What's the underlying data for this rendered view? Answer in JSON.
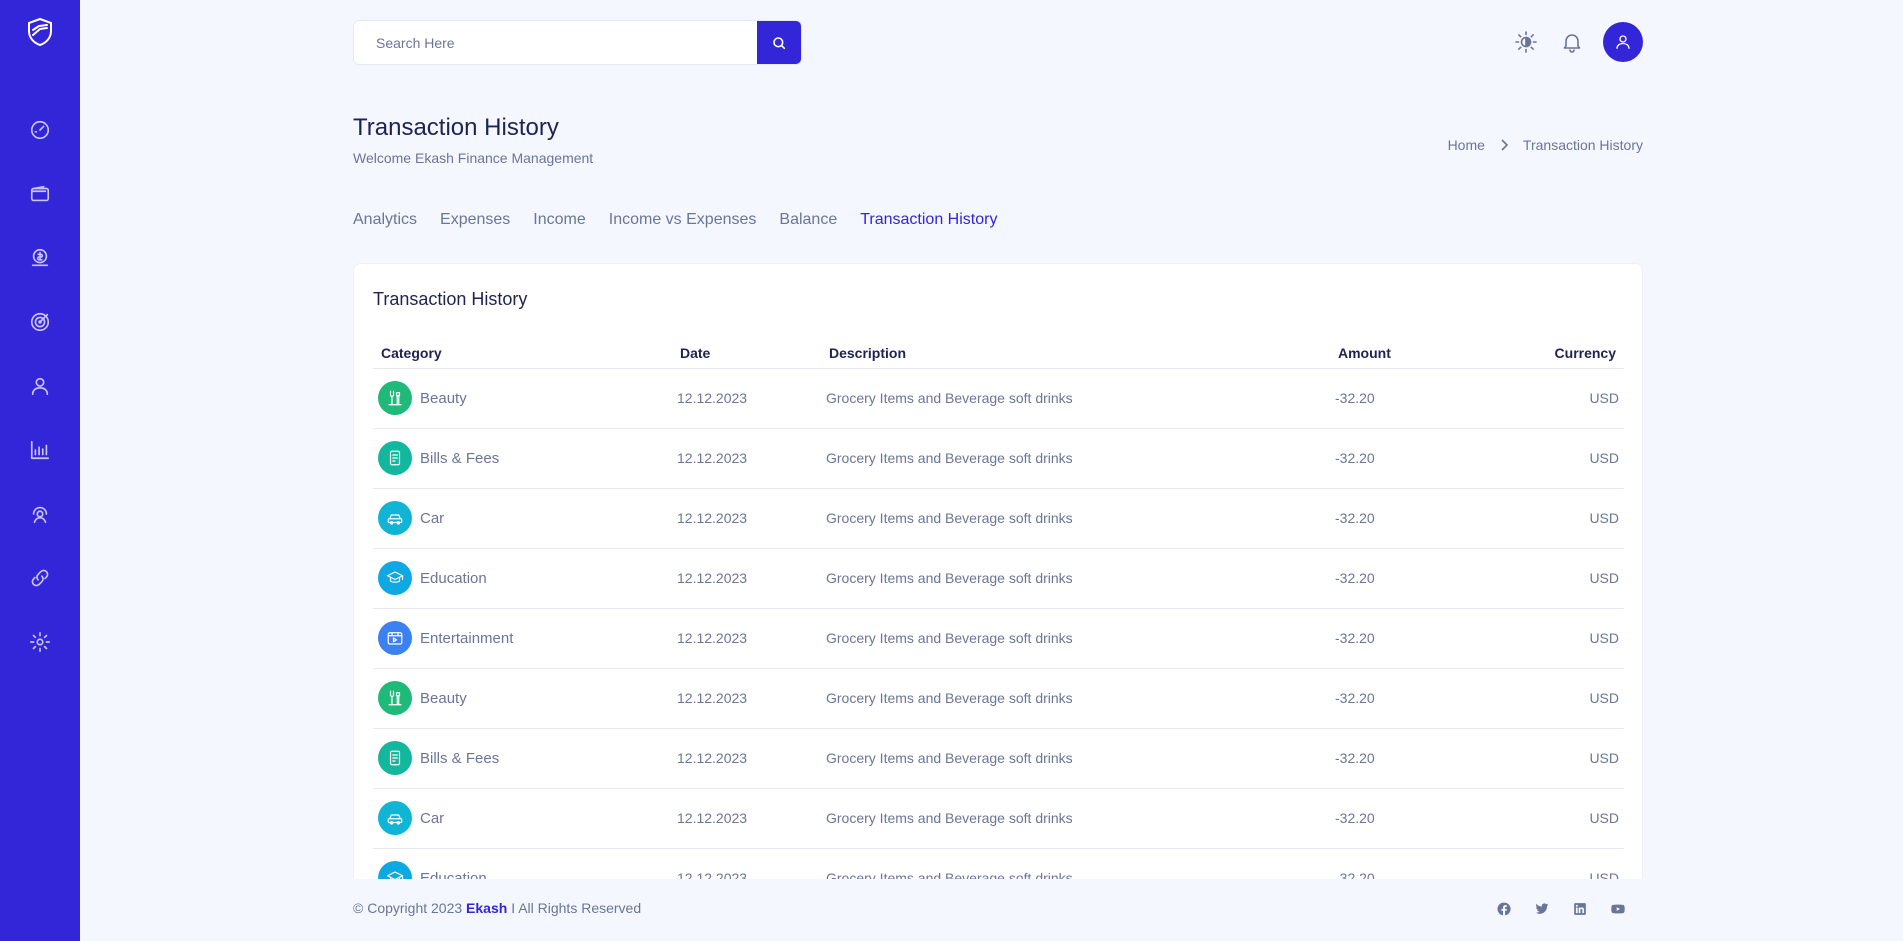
{
  "search": {
    "placeholder": "Search Here"
  },
  "page": {
    "title": "Transaction History",
    "subtitle": "Welcome Ekash Finance Management"
  },
  "breadcrumb": {
    "home": "Home",
    "current": "Transaction History"
  },
  "tabs": [
    {
      "label": "Analytics",
      "active": false
    },
    {
      "label": "Expenses",
      "active": false
    },
    {
      "label": "Income",
      "active": false
    },
    {
      "label": "Income vs Expenses",
      "active": false
    },
    {
      "label": "Balance",
      "active": false
    },
    {
      "label": "Transaction History",
      "active": true
    }
  ],
  "table": {
    "title": "Transaction History",
    "headers": {
      "category": "Category",
      "date": "Date",
      "description": "Description",
      "amount": "Amount",
      "currency": "Currency"
    },
    "rows": [
      {
        "category": "Beauty",
        "icon": "beauty-icon",
        "color": "#1fb979",
        "date": "12.12.2023",
        "description": "Grocery Items and Beverage soft drinks",
        "amount": "-32.20",
        "currency": "USD"
      },
      {
        "category": "Bills & Fees",
        "icon": "bill-icon",
        "color": "#13b79d",
        "date": "12.12.2023",
        "description": "Grocery Items and Beverage soft drinks",
        "amount": "-32.20",
        "currency": "USD"
      },
      {
        "category": "Car",
        "icon": "car-icon",
        "color": "#10b5d5",
        "date": "12.12.2023",
        "description": "Grocery Items and Beverage soft drinks",
        "amount": "-32.20",
        "currency": "USD"
      },
      {
        "category": "Education",
        "icon": "graduation-cap-icon",
        "color": "#0ea8e3",
        "date": "12.12.2023",
        "description": "Grocery Items and Beverage soft drinks",
        "amount": "-32.20",
        "currency": "USD"
      },
      {
        "category": "Entertainment",
        "icon": "entertainment-icon",
        "color": "#3b82f0",
        "date": "12.12.2023",
        "description": "Grocery Items and Beverage soft drinks",
        "amount": "-32.20",
        "currency": "USD"
      },
      {
        "category": "Beauty",
        "icon": "beauty-icon",
        "color": "#1fb979",
        "date": "12.12.2023",
        "description": "Grocery Items and Beverage soft drinks",
        "amount": "-32.20",
        "currency": "USD"
      },
      {
        "category": "Bills & Fees",
        "icon": "bill-icon",
        "color": "#13b79d",
        "date": "12.12.2023",
        "description": "Grocery Items and Beverage soft drinks",
        "amount": "-32.20",
        "currency": "USD"
      },
      {
        "category": "Car",
        "icon": "car-icon",
        "color": "#10b5d5",
        "date": "12.12.2023",
        "description": "Grocery Items and Beverage soft drinks",
        "amount": "-32.20",
        "currency": "USD"
      },
      {
        "category": "Education",
        "icon": "graduation-cap-icon",
        "color": "#0ea8e3",
        "date": "12.12.2023",
        "description": "Grocery Items and Beverage soft drinks",
        "amount": "-32.20",
        "currency": "USD"
      }
    ]
  },
  "footer": {
    "copyright_prefix": "© Copyright 2023",
    "brand": "Ekash",
    "copyright_suffix": "I All Rights Reserved"
  },
  "colors": {
    "primary": "#3325d8",
    "background": "#f4f7fd",
    "heading": "#1e2351",
    "text": "#6b7597"
  }
}
